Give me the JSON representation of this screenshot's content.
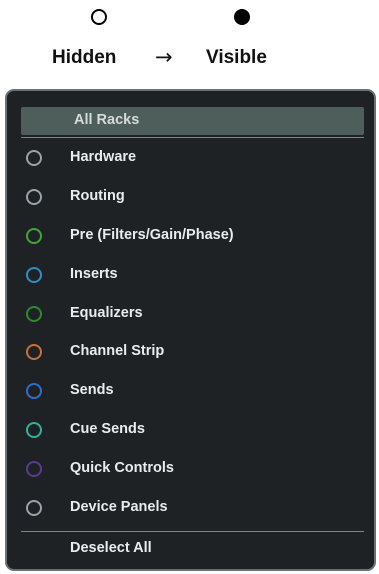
{
  "legend": {
    "hidden_label": "Hidden",
    "arrow": "→",
    "visible_label": "Visible"
  },
  "menu": {
    "header": "All Racks",
    "items": [
      {
        "label": "Hardware",
        "color": "#9aa3aa"
      },
      {
        "label": "Routing",
        "color": "#9aa3aa"
      },
      {
        "label": "Pre (Filters/Gain/Phase)",
        "color": "#3fa63a"
      },
      {
        "label": "Inserts",
        "color": "#2f8fc0"
      },
      {
        "label": "Equalizers",
        "color": "#2e8a2c"
      },
      {
        "label": "Channel Strip",
        "color": "#c8703a"
      },
      {
        "label": "Sends",
        "color": "#2d6ec9"
      },
      {
        "label": "Cue Sends",
        "color": "#2fb39a"
      },
      {
        "label": "Quick Controls",
        "color": "#5a3a92"
      },
      {
        "label": "Device Panels",
        "color": "#9aa3aa"
      }
    ],
    "deselect": "Deselect All"
  }
}
